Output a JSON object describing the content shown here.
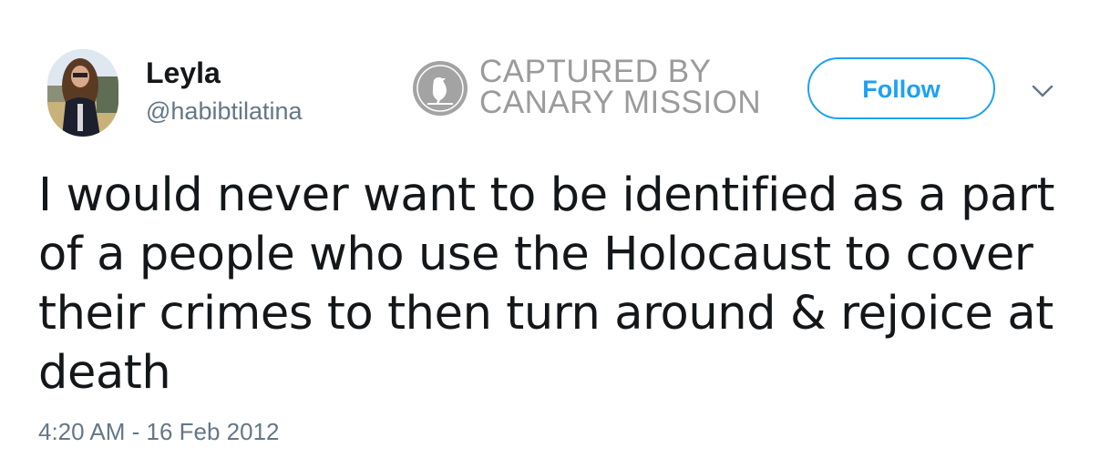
{
  "user": {
    "display_name": "Leyla",
    "handle": "@habibtilatina"
  },
  "watermark": {
    "line1": "CAPTURED BY",
    "line2": "CANARY MISSION",
    "icon": "canary-bird-icon"
  },
  "actions": {
    "follow_label": "Follow",
    "more_icon": "chevron-down-icon"
  },
  "tweet": {
    "lines": [
      "I would never want to be identified as a part",
      "of a people who use the Holocaust to cover",
      "their crimes to then turn around & rejoice at",
      "death"
    ],
    "timestamp": "4:20 AM - 16 Feb 2012"
  },
  "colors": {
    "accent": "#1da1f2",
    "text": "#14171a",
    "secondary": "#657786",
    "watermark": "#9b9b9b"
  }
}
